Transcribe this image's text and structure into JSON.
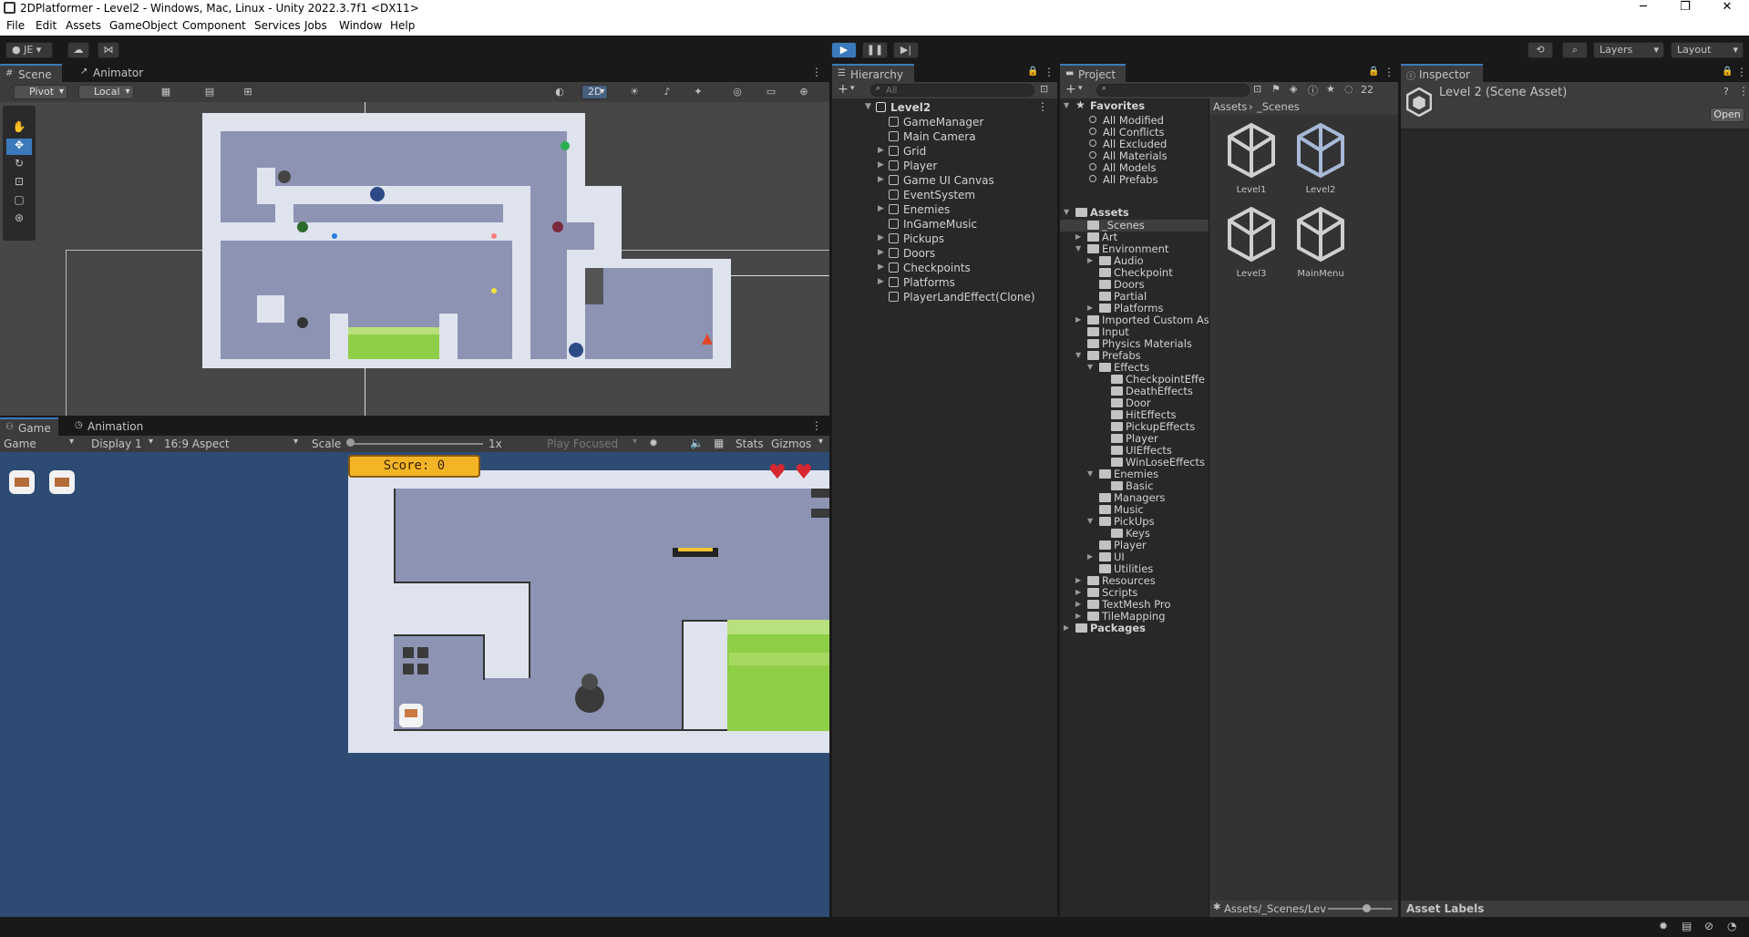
{
  "window": {
    "title": "2DPlatformer - Level2 - Windows, Mac, Linux - Unity 2022.3.7f1 <DX11>",
    "controls": [
      "─",
      "❐",
      "✕"
    ]
  },
  "menu": [
    "File",
    "Edit",
    "Assets",
    "GameObject",
    "Component",
    "Services",
    "Jobs",
    "Window",
    "Help"
  ],
  "toolbar": {
    "account": "JE",
    "layers": "Layers",
    "layout": "Layout"
  },
  "scene": {
    "tabs": [
      "Scene",
      "Animator"
    ],
    "pivot": "Pivot",
    "local": "Local",
    "mode_2d": "2D"
  },
  "game": {
    "tabs": [
      "Game",
      "Animation"
    ],
    "display_mode": "Game",
    "display": "Display 1",
    "aspect": "16:9 Aspect",
    "scale_label": "Scale",
    "scale_value": "1x",
    "play_focused": "Play Focused",
    "stats": "Stats",
    "gizmos": "Gizmos",
    "score": "Score: 0"
  },
  "hierarchy": {
    "tab": "Hierarchy",
    "search_placeholder": "All",
    "scene": "Level2",
    "items": [
      {
        "label": "GameManager",
        "expandable": false
      },
      {
        "label": "Main Camera",
        "expandable": false
      },
      {
        "label": "Grid",
        "expandable": true
      },
      {
        "label": "Player",
        "expandable": true
      },
      {
        "label": "Game UI Canvas",
        "expandable": true
      },
      {
        "label": "EventSystem",
        "expandable": false
      },
      {
        "label": "Enemies",
        "expandable": true
      },
      {
        "label": "InGameMusic",
        "expandable": false
      },
      {
        "label": "Pickups",
        "expandable": true
      },
      {
        "label": "Doors",
        "expandable": true
      },
      {
        "label": "Checkpoints",
        "expandable": true
      },
      {
        "label": "Platforms",
        "expandable": true
      },
      {
        "label": "PlayerLandEffect(Clone)",
        "expandable": false
      }
    ]
  },
  "project": {
    "tab": "Project",
    "hidden_count": "22",
    "favorites_label": "Favorites",
    "favorites": [
      "All Modified",
      "All Conflicts",
      "All Excluded",
      "All Materials",
      "All Models",
      "All Prefabs"
    ],
    "assets_label": "Assets",
    "tree": [
      {
        "label": "_Scenes",
        "depth": 1,
        "arrow": "",
        "selected": true
      },
      {
        "label": "Art",
        "depth": 1,
        "arrow": "▶"
      },
      {
        "label": "Environment",
        "depth": 1,
        "arrow": "▼"
      },
      {
        "label": "Audio",
        "depth": 2,
        "arrow": "▶"
      },
      {
        "label": "Checkpoint",
        "depth": 2,
        "arrow": ""
      },
      {
        "label": "Doors",
        "depth": 2,
        "arrow": ""
      },
      {
        "label": "Partial",
        "depth": 2,
        "arrow": ""
      },
      {
        "label": "Platforms",
        "depth": 2,
        "arrow": "▶"
      },
      {
        "label": "Imported Custom Ass",
        "depth": 1,
        "arrow": "▶"
      },
      {
        "label": "Input",
        "depth": 1,
        "arrow": ""
      },
      {
        "label": "Physics Materials",
        "depth": 1,
        "arrow": ""
      },
      {
        "label": "Prefabs",
        "depth": 1,
        "arrow": "▼"
      },
      {
        "label": "Effects",
        "depth": 2,
        "arrow": "▼"
      },
      {
        "label": "CheckpointEffe",
        "depth": 3,
        "arrow": ""
      },
      {
        "label": "DeathEffects",
        "depth": 3,
        "arrow": ""
      },
      {
        "label": "Door",
        "depth": 3,
        "arrow": ""
      },
      {
        "label": "HitEffects",
        "depth": 3,
        "arrow": ""
      },
      {
        "label": "PickupEffects",
        "depth": 3,
        "arrow": ""
      },
      {
        "label": "Player",
        "depth": 3,
        "arrow": ""
      },
      {
        "label": "UIEffects",
        "depth": 3,
        "arrow": ""
      },
      {
        "label": "WinLoseEffects",
        "depth": 3,
        "arrow": ""
      },
      {
        "label": "Enemies",
        "depth": 2,
        "arrow": "▼"
      },
      {
        "label": "Basic",
        "depth": 3,
        "arrow": ""
      },
      {
        "label": "Managers",
        "depth": 2,
        "arrow": ""
      },
      {
        "label": "Music",
        "depth": 2,
        "arrow": ""
      },
      {
        "label": "PickUps",
        "depth": 2,
        "arrow": "▼"
      },
      {
        "label": "Keys",
        "depth": 3,
        "arrow": ""
      },
      {
        "label": "Player",
        "depth": 2,
        "arrow": ""
      },
      {
        "label": "UI",
        "depth": 2,
        "arrow": "▶"
      },
      {
        "label": "Utilities",
        "depth": 2,
        "arrow": ""
      },
      {
        "label": "Resources",
        "depth": 1,
        "arrow": "▶"
      },
      {
        "label": "Scripts",
        "depth": 1,
        "arrow": "▶"
      },
      {
        "label": "TextMesh Pro",
        "depth": 1,
        "arrow": "▶"
      },
      {
        "label": "TileMapping",
        "depth": 1,
        "arrow": "▶"
      }
    ],
    "packages_label": "Packages",
    "breadcrumb": [
      "Assets",
      "_Scenes"
    ],
    "assets": [
      {
        "name": "Level1",
        "selected": false
      },
      {
        "name": "Level2",
        "selected": true
      },
      {
        "name": "Level3",
        "selected": false
      },
      {
        "name": "MainMenu",
        "selected": false
      }
    ],
    "path": "Assets/_Scenes/Lev"
  },
  "inspector": {
    "tab": "Inspector",
    "title": "Level 2 (Scene Asset)",
    "open": "Open",
    "asset_labels": "Asset Labels"
  },
  "colors": {
    "accent": "#3a79bb",
    "panel": "#282828",
    "game_bg": "#2d4b73",
    "level_wall": "#dfe3ee",
    "level_room": "#8d93b3",
    "grass": "#8fcf47",
    "heart": "#d6262f",
    "score_bg": "#f3b526"
  }
}
